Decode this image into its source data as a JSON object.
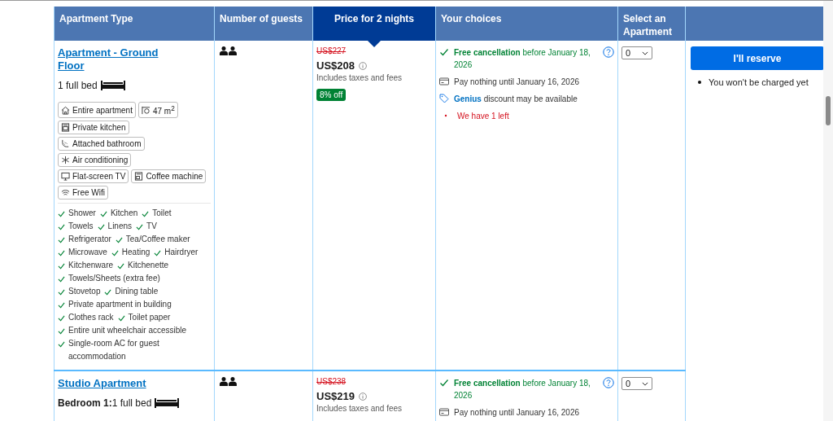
{
  "columns": [
    {
      "label": "Apartment Type",
      "selected": false
    },
    {
      "label": "Number of guests",
      "selected": false
    },
    {
      "label": "Price for 2 nights",
      "selected": true
    },
    {
      "label": "Your choices",
      "selected": false
    },
    {
      "label": "Select an Apartment",
      "selected": false
    }
  ],
  "reserve": {
    "button": "I'll reserve",
    "note": "You won't be charged yet"
  },
  "rows": [
    {
      "name": "Apartment - Ground Floor",
      "beds": [
        {
          "text": "1 full bed",
          "kind": "full"
        }
      ],
      "chips": [
        [
          {
            "kind": "house",
            "label": "Entire apartment"
          },
          {
            "kind": "size",
            "label": "47 m$^{2}$"
          }
        ],
        [
          {
            "kind": "kitchen",
            "label": "Private kitchen"
          }
        ],
        [
          {
            "kind": "bath",
            "label": "Attached bathroom"
          }
        ],
        [
          {
            "kind": "snow",
            "label": "Air conditioning"
          }
        ],
        [
          {
            "kind": "tv",
            "label": "Flat-screen TV"
          },
          {
            "kind": "coffee",
            "label": "Coffee machine"
          }
        ],
        [
          {
            "kind": "wifi",
            "label": "Free Wifi"
          }
        ]
      ],
      "amenities": [
        [
          "Shower",
          "Kitchen",
          "Toilet"
        ],
        [
          "Towels",
          "Linens",
          "TV"
        ],
        [
          "Refrigerator",
          "Tea/Coffee maker"
        ],
        [
          "Microwave",
          "Heating",
          "Hairdryer"
        ],
        [
          "Kitchenware",
          "Kitchenette"
        ],
        [
          "Towels/Sheets (extra fee)"
        ],
        [
          "Stovetop",
          "Dining table"
        ],
        [
          "Private apartment in building"
        ],
        [
          "Clothes rack",
          "Toilet paper"
        ],
        [
          "Entire unit wheelchair accessible"
        ],
        [
          "Single-room AC for guest accommodation"
        ]
      ],
      "old_price": "US$227",
      "price": "US$208",
      "price_note": "Includes taxes and fees",
      "discount": "8% off",
      "choices": [
        {
          "kind": "cancel",
          "bold": "Free cancellation",
          "text": "before January 18, 2026"
        },
        {
          "kind": "pay",
          "text": "Pay nothing until January 16, 2026"
        },
        {
          "kind": "genius",
          "bold": "Genius",
          "text": "discount may be available"
        },
        {
          "kind": "scarcity",
          "text": "We have 1 left"
        }
      ],
      "quantity": "0"
    },
    {
      "name": "Studio Apartment",
      "beds": [
        {
          "room": "Bedroom 1:",
          "text": "1 full bed",
          "kind": "full"
        }
      ],
      "chips": [],
      "amenities": [],
      "old_price": "US$238",
      "price": "US$219",
      "price_note": "Includes taxes and fees",
      "choices": [
        {
          "kind": "cancel",
          "bold": "Free cancellation",
          "text": "before January 18, 2026"
        },
        {
          "kind": "pay",
          "text": "Pay nothing until January 16, 2026"
        }
      ],
      "quantity": "0"
    }
  ]
}
